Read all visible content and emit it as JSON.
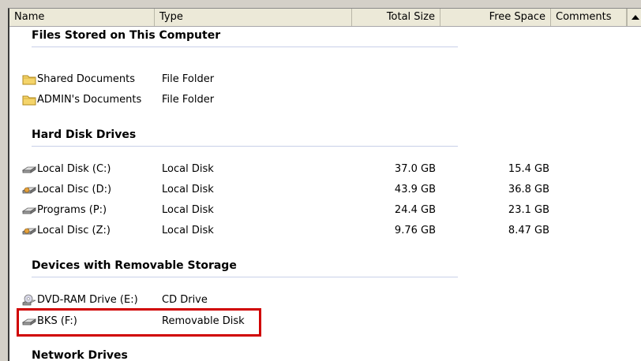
{
  "columns": {
    "name": "Name",
    "type": "Type",
    "total_size": "Total Size",
    "free_space": "Free Space",
    "comments": "Comments"
  },
  "groups": {
    "files": {
      "title": "Files Stored on This Computer",
      "items": [
        {
          "name": "Shared Documents",
          "type": "File Folder",
          "icon": "folder-icon"
        },
        {
          "name": "ADMIN's Documents",
          "type": "File Folder",
          "icon": "folder-icon"
        }
      ]
    },
    "hard_disks": {
      "title": "Hard Disk Drives",
      "items": [
        {
          "name": "Local Disk (C:)",
          "type": "Local Disk",
          "total": "37.0 GB",
          "free": "15.4 GB",
          "icon": "hard-drive-icon"
        },
        {
          "name": "Local Disc (D:)",
          "type": "Local Disk",
          "total": "43.9 GB",
          "free": "36.8 GB",
          "icon": "hard-drive-icon"
        },
        {
          "name": "Programs (P:)",
          "type": "Local Disk",
          "total": "24.4 GB",
          "free": "23.1 GB",
          "icon": "hard-drive-icon"
        },
        {
          "name": "Local Disc (Z:)",
          "type": "Local Disk",
          "total": "9.76 GB",
          "free": "8.47 GB",
          "icon": "hard-drive-icon"
        }
      ]
    },
    "removable": {
      "title": "Devices with Removable Storage",
      "items": [
        {
          "name": "DVD-RAM Drive (E:)",
          "type": "CD Drive",
          "icon": "dvd-drive-icon"
        },
        {
          "name": "BKS (F:)",
          "type": "Removable Disk",
          "icon": "removable-disk-icon"
        }
      ]
    },
    "network": {
      "title": "Network Drives"
    }
  },
  "colors": {
    "highlight": "#d00000",
    "folder": "#f4d46a"
  }
}
